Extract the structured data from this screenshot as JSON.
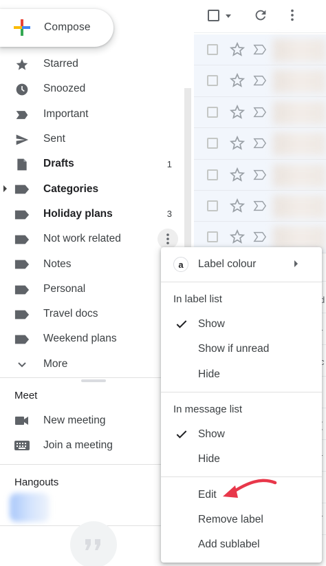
{
  "compose": {
    "label": "Compose"
  },
  "sidebar": {
    "items": [
      {
        "label": "Starred",
        "icon": "star-icon",
        "bold": false,
        "count": ""
      },
      {
        "label": "Snoozed",
        "icon": "clock-icon",
        "bold": false,
        "count": ""
      },
      {
        "label": "Important",
        "icon": "important-icon",
        "bold": false,
        "count": ""
      },
      {
        "label": "Sent",
        "icon": "send-icon",
        "bold": false,
        "count": ""
      },
      {
        "label": "Drafts",
        "icon": "draft-icon",
        "bold": true,
        "count": "1"
      },
      {
        "label": "Categories",
        "icon": "label-icon",
        "bold": true,
        "count": ""
      },
      {
        "label": "Holiday plans",
        "icon": "label-icon",
        "bold": true,
        "count": "3"
      },
      {
        "label": "Not work related",
        "icon": "label-icon",
        "bold": false,
        "count": ""
      },
      {
        "label": "Notes",
        "icon": "label-icon",
        "bold": false,
        "count": ""
      },
      {
        "label": "Personal",
        "icon": "label-icon",
        "bold": false,
        "count": ""
      },
      {
        "label": "Travel docs",
        "icon": "label-icon",
        "bold": false,
        "count": ""
      },
      {
        "label": "Weekend plans",
        "icon": "label-icon",
        "bold": false,
        "count": ""
      },
      {
        "label": "More",
        "icon": "chevron-down-icon",
        "bold": false,
        "count": ""
      }
    ]
  },
  "meet": {
    "title": "Meet",
    "items": [
      {
        "label": "New meeting",
        "icon": "video-camera-icon"
      },
      {
        "label": "Join a meeting",
        "icon": "keyboard-icon"
      }
    ]
  },
  "hangouts": {
    "title": "Hangouts"
  },
  "mail": {
    "rows": 7,
    "right_fragments": [
      "i",
      "d",
      "r",
      "c",
      "(",
      "r",
      "i",
      "r"
    ]
  },
  "menu": {
    "label_colour": {
      "badge": "a",
      "label": "Label colour"
    },
    "in_label_list": {
      "heading": "In label list",
      "options": [
        "Show",
        "Show if unread",
        "Hide"
      ],
      "selected": "Show"
    },
    "in_message_list": {
      "heading": "In message list",
      "options": [
        "Show",
        "Hide"
      ],
      "selected": "Show"
    },
    "actions": [
      "Edit",
      "Remove label",
      "Add sublabel"
    ]
  },
  "colors": {
    "annotation_arrow": "#e8374a",
    "selected_row_bg": "#f2f6fc"
  }
}
